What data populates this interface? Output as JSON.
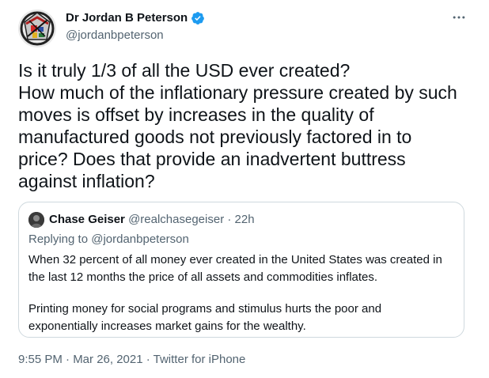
{
  "author": {
    "name": "Dr Jordan B Peterson",
    "handle": "@jordanbpeterson",
    "verified": true
  },
  "tweet": {
    "lines": [
      "Is it truly 1/3 of all the USD ever created?",
      "How much of the inflationary pressure created by such",
      "moves is offset by increases in the quality of",
      "manufactured goods not previously factored in to",
      "price? Does that provide an inadvertent buttress",
      "against inflation?"
    ]
  },
  "quoted": {
    "name": "Chase Geiser",
    "handle": "@realchasegeiser",
    "separator": " · ",
    "time": "22h",
    "replying_to": "Replying to @jordanbpeterson",
    "paragraph1": [
      "When 32 percent of all money ever created in the United States was created in",
      "the last 12 months the price of all assets and commodities inflates."
    ],
    "paragraph2": [
      "Printing money for social programs and stimulus hurts the poor and",
      "exponentially increases market gains for the wealthy."
    ]
  },
  "footer": {
    "text": "9:55 PM · Mar 26, 2021 · Twitter for iPhone"
  },
  "colors": {
    "text": "#0f1419",
    "secondary": "#536471",
    "verified": "#1d9bf0",
    "border": "#cfd9de"
  },
  "icons": {
    "verified": "verified-badge-icon",
    "more": "more-horizontal-icon"
  }
}
